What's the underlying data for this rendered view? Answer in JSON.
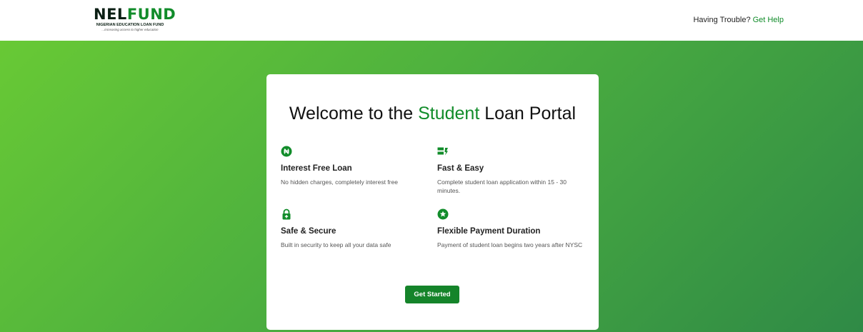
{
  "header": {
    "logo": {
      "main_part1": "NEL",
      "main_part2": "FUND",
      "subtitle": "NIGERIAN EDUCATION LOAN FUND",
      "tagline": "...increasing access to higher education"
    },
    "help_text": "Having Trouble?",
    "help_link": "Get Help"
  },
  "card": {
    "title_before": "Welcome to the ",
    "title_accent": "Student",
    "title_after": " Loan Portal",
    "features": [
      {
        "icon": "naira-icon",
        "title": "Interest Free Loan",
        "description": "No hidden charges, completely interest free"
      },
      {
        "icon": "fast-icon",
        "title": "Fast & Easy",
        "description": "Complete student loan application within 15 - 30 minutes."
      },
      {
        "icon": "lock-icon",
        "title": "Safe & Secure",
        "description": "Built in security to keep all your data safe"
      },
      {
        "icon": "star-badge-icon",
        "title": "Flexible Payment Duration",
        "description": "Payment of student loan begins two years after NYSC"
      }
    ],
    "cta_label": "Get Started"
  },
  "colors": {
    "brand_green": "#118c2a",
    "button_green": "#15842a",
    "hero_gradient_start": "#68c935",
    "hero_gradient_end": "#2f8a46"
  }
}
